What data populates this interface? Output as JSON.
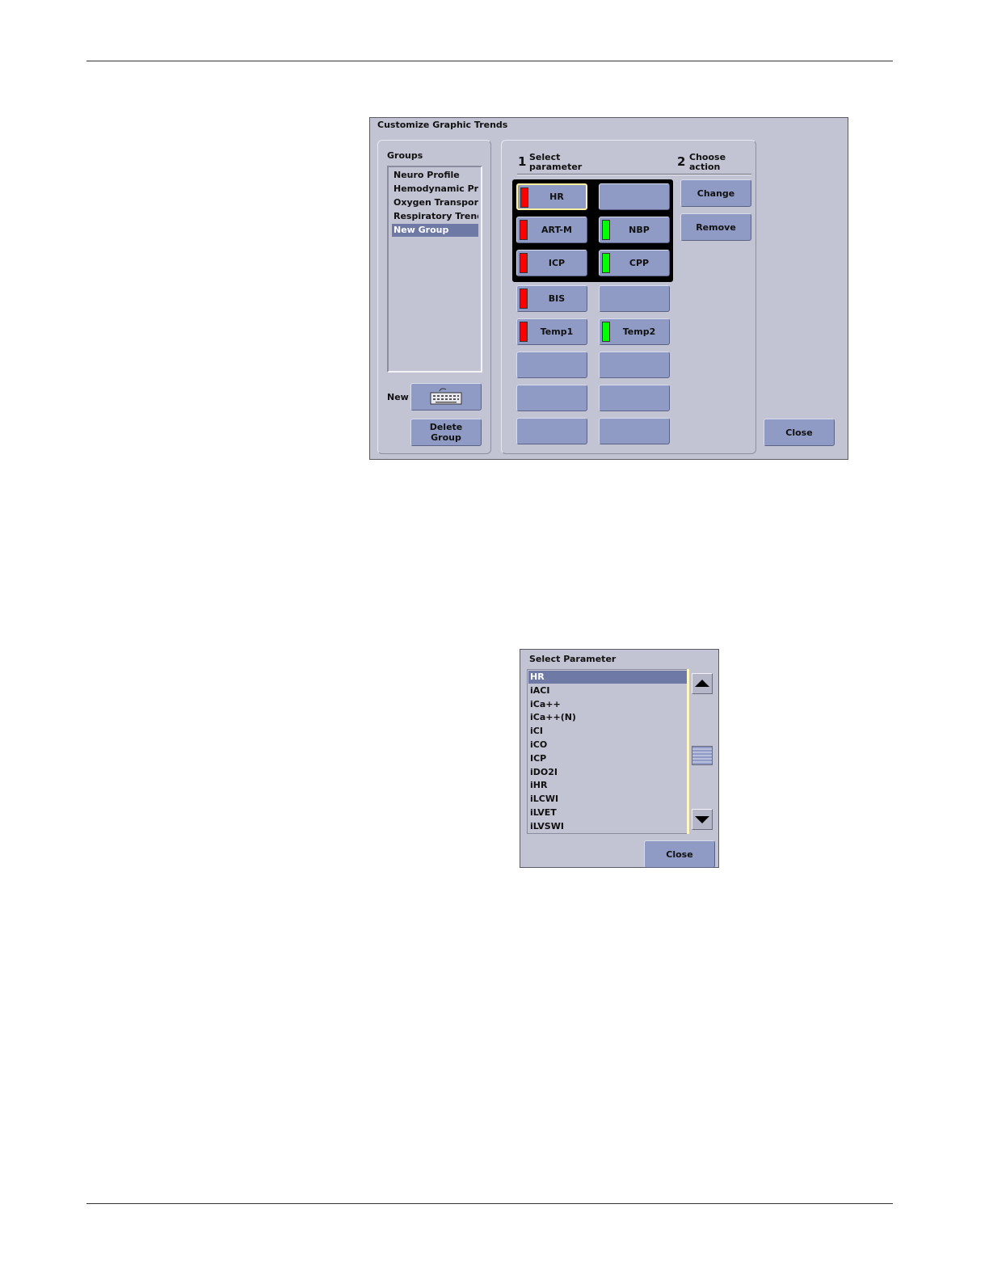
{
  "customize_dialog": {
    "title": "Customize Graphic Trends",
    "groups": {
      "title": "Groups",
      "items": [
        "Neuro Profile",
        "Hemodynamic Prof",
        "Oxygen Transport",
        "Respiratory Trends",
        "New Group"
      ],
      "selected": "New Group",
      "new_label": "New",
      "new_button_icon": "keyboard-icon",
      "delete_label": "Delete\nGroup"
    },
    "steps": {
      "step1_number": "1",
      "step1_label_line1": "Select",
      "step1_label_line2": "parameter",
      "step2_number": "2",
      "step2_label_line1": "Choose",
      "step2_label_line2": "action"
    },
    "parameters": [
      {
        "label": "HR",
        "color": "#ff0000",
        "active": true
      },
      {
        "label": "",
        "color": null
      },
      {
        "label": "ART-M",
        "color": "#ff0000"
      },
      {
        "label": "NBP",
        "color": "#00ff00"
      },
      {
        "label": "ICP",
        "color": "#ff0000"
      },
      {
        "label": "CPP",
        "color": "#00ff00"
      },
      {
        "label": "BIS",
        "color": "#ff0000"
      },
      {
        "label": "",
        "color": null
      },
      {
        "label": "Temp1",
        "color": "#ff0000"
      },
      {
        "label": "Temp2",
        "color": "#00ff00"
      },
      {
        "label": "",
        "color": null
      },
      {
        "label": "",
        "color": null
      },
      {
        "label": "",
        "color": null
      },
      {
        "label": "",
        "color": null
      },
      {
        "label": "",
        "color": null
      },
      {
        "label": "",
        "color": null
      }
    ],
    "actions": {
      "change": "Change",
      "remove": "Remove"
    },
    "close": "Close"
  },
  "select_dialog": {
    "title": "Select Parameter",
    "items": [
      "HR",
      "iACI",
      "iCa++",
      "iCa++(N)",
      "iCI",
      "iCO",
      "ICP",
      "iDO2I",
      "iHR",
      "iLCWI",
      "iLVET",
      "iLVSWI"
    ],
    "selected": "HR",
    "close": "Close"
  },
  "colors": {
    "dialog_bg": "#c2c3d3",
    "button_bg": "#8f9bc4",
    "selection_bg": "#6f79a6"
  }
}
